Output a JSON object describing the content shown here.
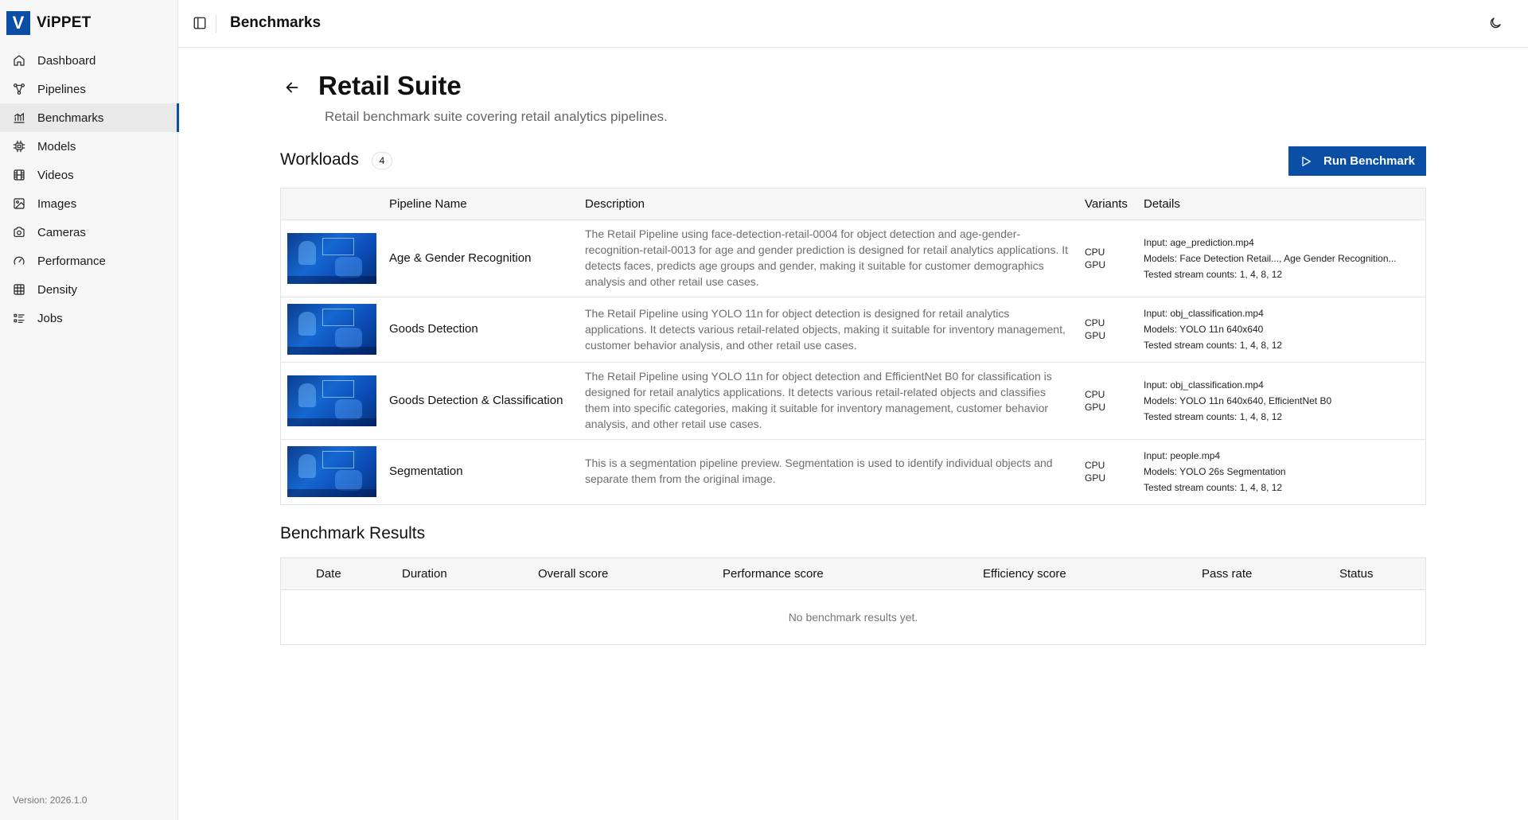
{
  "brand": {
    "logo_letter": "V",
    "name": "ViPPET"
  },
  "nav": [
    {
      "label": "Dashboard",
      "icon": "home-icon"
    },
    {
      "label": "Pipelines",
      "icon": "pipeline-icon"
    },
    {
      "label": "Benchmarks",
      "icon": "chart-icon",
      "active": true
    },
    {
      "label": "Models",
      "icon": "chip-icon"
    },
    {
      "label": "Videos",
      "icon": "film-icon"
    },
    {
      "label": "Images",
      "icon": "image-icon"
    },
    {
      "label": "Cameras",
      "icon": "camera-icon"
    },
    {
      "label": "Performance",
      "icon": "gauge-icon"
    },
    {
      "label": "Density",
      "icon": "grid-icon"
    },
    {
      "label": "Jobs",
      "icon": "list-icon"
    }
  ],
  "version": "Version: 2026.1.0",
  "topbar": {
    "title": "Benchmarks"
  },
  "page": {
    "title": "Retail Suite",
    "subtitle": "Retail benchmark suite covering retail analytics pipelines."
  },
  "workloads": {
    "title": "Workloads",
    "count": "4",
    "run_label": "Run Benchmark",
    "columns": [
      "Pipeline Name",
      "Description",
      "Variants",
      "Details"
    ],
    "rows": [
      {
        "name": "Age & Gender Recognition",
        "description": "The Retail Pipeline using face-detection-retail-0004 for object detection and age-gender-recognition-retail-0013 for age and gender prediction is designed for retail analytics applications. It detects faces, predicts age groups and gender, making it suitable for customer demographics analysis and other retail use cases.",
        "variants": [
          "CPU",
          "GPU"
        ],
        "input": "Input: age_prediction.mp4",
        "models": "Models: Face Detection Retail..., Age Gender Recognition...",
        "streams": "Tested stream counts: 1, 4, 8, 12"
      },
      {
        "name": "Goods Detection",
        "description": "The Retail Pipeline using YOLO 11n for object detection is designed for retail analytics applications. It detects various retail-related objects, making it suitable for inventory management, customer behavior analysis, and other retail use cases.",
        "variants": [
          "CPU",
          "GPU"
        ],
        "input": "Input: obj_classification.mp4",
        "models": "Models: YOLO 11n 640x640",
        "streams": "Tested stream counts: 1, 4, 8, 12"
      },
      {
        "name": "Goods Detection & Classification",
        "description": "The Retail Pipeline using YOLO 11n for object detection and EfficientNet B0 for classification is designed for retail analytics applications. It detects various retail-related objects and classifies them into specific categories, making it suitable for inventory management, customer behavior analysis, and other retail use cases.",
        "variants": [
          "CPU",
          "GPU"
        ],
        "input": "Input: obj_classification.mp4",
        "models": "Models: YOLO 11n 640x640, EfficientNet B0",
        "streams": "Tested stream counts: 1, 4, 8, 12"
      },
      {
        "name": "Segmentation",
        "description": "This is a segmentation pipeline preview. Segmentation is used to identify individual objects and separate them from the original image.",
        "variants": [
          "CPU",
          "GPU"
        ],
        "input": "Input: people.mp4",
        "models": "Models: YOLO 26s Segmentation",
        "streams": "Tested stream counts: 1, 4, 8, 12"
      }
    ]
  },
  "results": {
    "title": "Benchmark Results",
    "columns": [
      "Date",
      "Duration",
      "Overall score",
      "Performance score",
      "Efficiency score",
      "Pass rate",
      "Status"
    ],
    "empty": "No benchmark results yet."
  }
}
